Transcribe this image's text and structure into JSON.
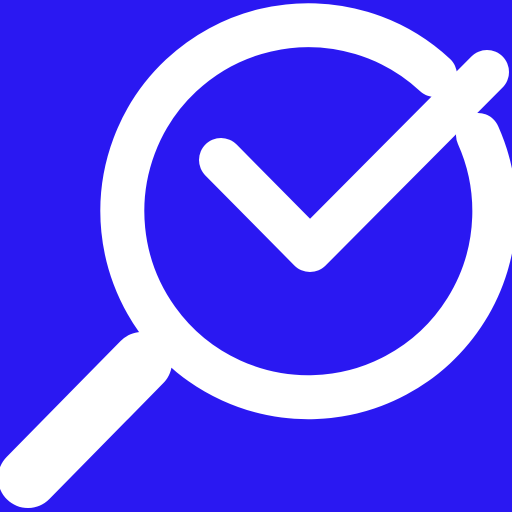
{
  "icon": {
    "name": "search-check-icon",
    "background_color": "#2a18f2",
    "foreground_color": "#ffffff"
  }
}
